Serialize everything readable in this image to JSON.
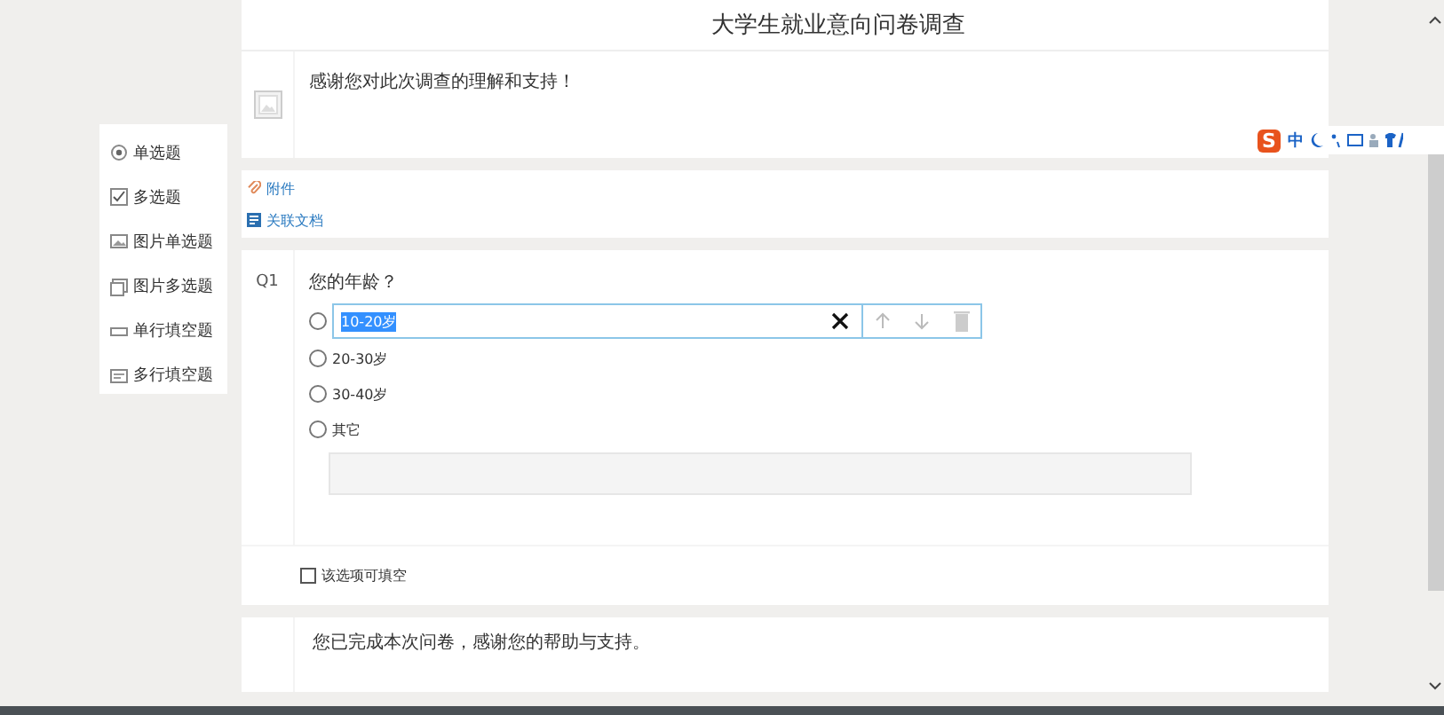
{
  "title": "大学生就业意向问卷调查",
  "intro": "感谢您对此次调查的理解和支持！",
  "palette": [
    {
      "kind": "radio",
      "label": "单选题"
    },
    {
      "kind": "checkbox",
      "label": "多选题"
    },
    {
      "kind": "image-radio",
      "label": "图片单选题"
    },
    {
      "kind": "image-checkbox",
      "label": "图片多选题"
    },
    {
      "kind": "single-line",
      "label": "单行填空题"
    },
    {
      "kind": "multi-line",
      "label": "多行填空题"
    }
  ],
  "links": [
    {
      "kind": "attachment",
      "label": "附件"
    },
    {
      "kind": "document",
      "label": "关联文档"
    }
  ],
  "question": {
    "number": "Q1",
    "text": "您的年龄？",
    "options": [
      {
        "label": "10-20岁",
        "kind": "editing",
        "selected": false
      },
      {
        "label": "20-30岁",
        "kind": "plain",
        "selected": false
      },
      {
        "label": "30-40岁",
        "kind": "plain",
        "selected": false
      },
      {
        "label": "其它",
        "kind": "fill",
        "selected": false
      }
    ]
  },
  "fillable": {
    "label": "该选项可填空",
    "checked": false
  },
  "ending": "您已完成本次问卷，感谢您的帮助与支持。",
  "ime": {
    "logo": "S",
    "mode": "中"
  }
}
